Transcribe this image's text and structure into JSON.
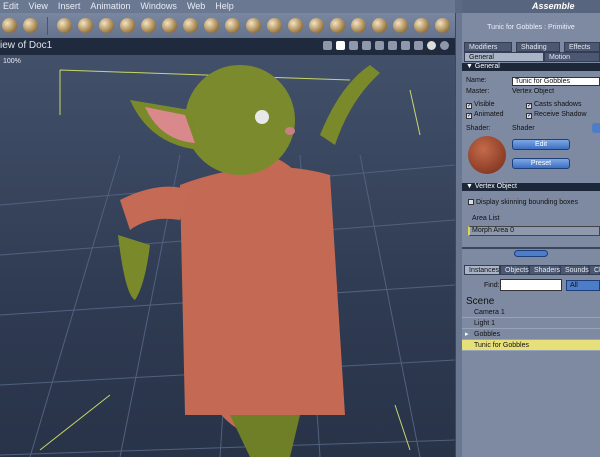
{
  "menu": [
    "Edit",
    "View",
    "Insert",
    "Animation",
    "Windows",
    "Web",
    "Help"
  ],
  "room": "Assemble",
  "viewport": {
    "title": "iew of Doc1",
    "zoom": "100%"
  },
  "panel": {
    "title": "Tunic for Gobbles : Primitive",
    "tabs_row1": [
      "Modifiers",
      "Shading",
      "Effects"
    ],
    "tabs_row2": [
      "General",
      "Motion"
    ],
    "general_section": "General",
    "name_label": "Name:",
    "name_value": "Tunic for Gobbles",
    "master_label": "Master:",
    "master_value": "Vertex Object",
    "visible": "Visible",
    "casts_shadows": "Casts shadows",
    "animated": "Animated",
    "receive_shadow": "Receive Shadow",
    "shader_label": "Shader:",
    "shader_value": "Shader",
    "edit": "Edit",
    "preset": "Preset",
    "vertex_section": "Vertex Object",
    "skinning": "Display skinning bounding boxes",
    "area_list": "Area List",
    "area_item": "Morph Area 0"
  },
  "browser": {
    "tabs": [
      "Instances",
      "Objects",
      "Shaders",
      "Sounds",
      "Cl"
    ],
    "find_label": "Find:",
    "find_value": "",
    "filter": "All",
    "scene": "Scene",
    "items": [
      "Camera 1",
      "Light 1",
      "Gobbles",
      "Tunic for Gobbles"
    ],
    "selected_color": "#e7e07a"
  }
}
